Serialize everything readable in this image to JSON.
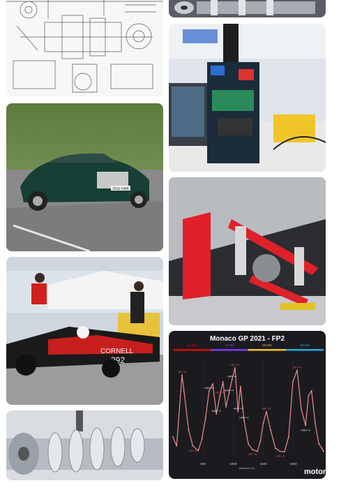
{
  "gallery": {
    "tiles": [
      {
        "name": "engineering-drawing",
        "kind": "drawing"
      },
      {
        "name": "green-luxury-sedan",
        "kind": "photo",
        "plate": "OG6 VWA"
      },
      {
        "name": "formula-race-car",
        "kind": "photo",
        "car_text": "CORNELL",
        "car_number": "292"
      },
      {
        "name": "machined-crankshaft",
        "kind": "photo"
      },
      {
        "name": "machined-part-strip",
        "kind": "photo"
      },
      {
        "name": "robot-electronics-lab",
        "kind": "photo"
      },
      {
        "name": "red-suspension-underside",
        "kind": "photo"
      },
      {
        "name": "monaco-speed-trace",
        "kind": "chart"
      }
    ]
  },
  "chart": {
    "title": "Monaco GP 2021 - FP2",
    "sector_times": [
      "18.965",
      "18.965",
      "33.931",
      "33.931"
    ],
    "sector_colors": [
      "#e10600",
      "#7a3cf0",
      "#f4c430",
      "#2aa8e0"
    ],
    "xlabel": "Distance (m)",
    "watermark": "motor"
  },
  "chart_data": {
    "type": "line",
    "title": "Monaco GP 2021 - FP2",
    "xlabel": "Distance (m)",
    "x_ticks": [
      500,
      1000,
      1500,
      2000
    ],
    "xlim": [
      0,
      2500
    ],
    "series": [
      {
        "name": "",
        "color": "#f08a8a",
        "x": [
          0,
          60,
          150,
          260,
          330,
          420,
          480,
          540,
          600,
          660,
          720,
          780,
          830,
          880,
          930,
          980,
          1030,
          1080,
          1120,
          1180,
          1250,
          1320,
          1400,
          1450,
          1500,
          1550,
          1620,
          1700,
          1780,
          1850,
          1920,
          1990,
          2060,
          2130,
          2200,
          2250,
          2300,
          2360,
          2420,
          2470,
          2500
        ],
        "y": [
          230,
          250,
          95,
          215,
          250,
          260,
          235,
          190,
          130,
          115,
          180,
          140,
          110,
          165,
          135,
          105,
          80,
          175,
          120,
          195,
          245,
          258,
          262,
          240,
          200,
          175,
          215,
          255,
          262,
          263,
          230,
          110,
          85,
          170,
          205,
          140,
          130,
          200,
          245,
          255,
          262
        ]
      }
    ]
  },
  "chart_annotations": [
    "LEC +4",
    "LEC +8",
    "HAM +5",
    "HAM +2",
    "LEC +6",
    "HAM +4",
    "HAM +3",
    "LEC +2",
    "HAM +5",
    "HAM +1",
    "LEC +5",
    "LEC +6",
    "LEC +4",
    "LEC +3",
    "HAM +4"
  ]
}
